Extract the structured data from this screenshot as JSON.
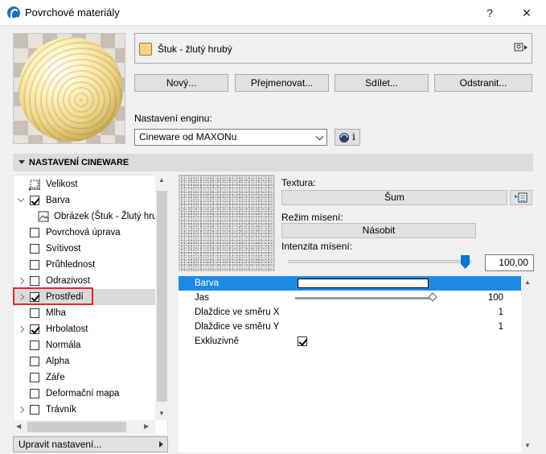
{
  "window": {
    "title": "Povrchové materiály",
    "help_label": "?",
    "close_label": "✕"
  },
  "material": {
    "name": "Štuk - žlutý hrubý",
    "swatch_color": "#fcd27f"
  },
  "actions": {
    "new": "Nový...",
    "rename": "Přejmenovat...",
    "share": "Sdílet...",
    "delete": "Odstranit..."
  },
  "engine": {
    "label": "Nastavení enginu:",
    "value": "Cineware od MAXONu",
    "info_label": "i"
  },
  "section": {
    "title": "NASTAVENÍ CINEWARE"
  },
  "tree": {
    "items": [
      {
        "label": "Velikost"
      },
      {
        "label": "Barva"
      },
      {
        "label": "Obrázek (Štuk - Žlutý hrubý)"
      },
      {
        "label": "Povrchová úprava"
      },
      {
        "label": "Svítivost"
      },
      {
        "label": "Průhlednost"
      },
      {
        "label": "Odrazivost"
      },
      {
        "label": "Prostředí"
      },
      {
        "label": "Mlha"
      },
      {
        "label": "Hrbolatost"
      },
      {
        "label": "Normála"
      },
      {
        "label": "Alpha"
      },
      {
        "label": "Záře"
      },
      {
        "label": "Deformační mapa"
      },
      {
        "label": "Trávník"
      }
    ],
    "edit_settings": "Upravit nastavení..."
  },
  "texture": {
    "label": "Textura:",
    "value": "Šum",
    "blend_mode_label": "Režim mísení:",
    "blend_mode_value": "Násobit",
    "blend_intensity_label": "Intenzita mísení:",
    "blend_intensity_value": "100,00",
    "blend_intensity": 1.0
  },
  "properties": {
    "rows": [
      {
        "name": "Barva",
        "value": ""
      },
      {
        "name": "Jas",
        "value": "100"
      },
      {
        "name": "Dlaždice ve směru X",
        "value": "1"
      },
      {
        "name": "Dlaždice ve směru Y",
        "value": "1"
      },
      {
        "name": "Exkluzivně",
        "value": ""
      }
    ],
    "brightness": 100,
    "exclusive_checked": true
  },
  "colors": {
    "accent": "#1e8ae5",
    "slider": "#0078d7",
    "highlight_frame": "#e3262b"
  }
}
